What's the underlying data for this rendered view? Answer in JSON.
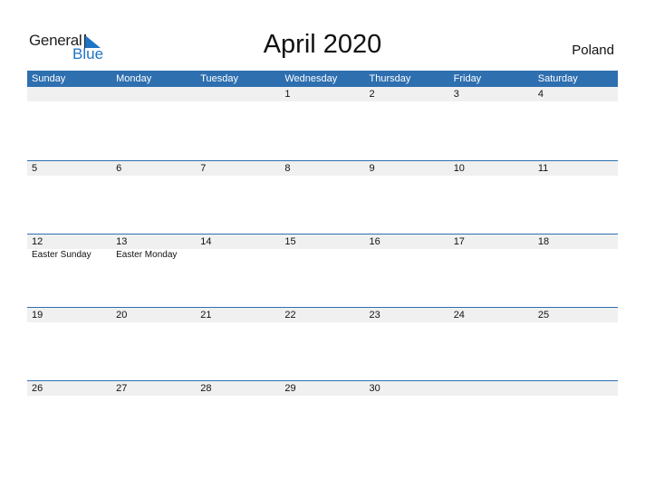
{
  "logo": {
    "general": "General",
    "blue": "Blue"
  },
  "title": "April 2020",
  "country": "Poland",
  "weekdays": [
    "Sunday",
    "Monday",
    "Tuesday",
    "Wednesday",
    "Thursday",
    "Friday",
    "Saturday"
  ],
  "colors": {
    "header": "#2e6fb0",
    "strip": "#f0f0f0",
    "brand_blue": "#1e74c4"
  },
  "weeks": [
    [
      {
        "day": ""
      },
      {
        "day": ""
      },
      {
        "day": ""
      },
      {
        "day": "1"
      },
      {
        "day": "2"
      },
      {
        "day": "3"
      },
      {
        "day": "4"
      }
    ],
    [
      {
        "day": "5"
      },
      {
        "day": "6"
      },
      {
        "day": "7"
      },
      {
        "day": "8"
      },
      {
        "day": "9"
      },
      {
        "day": "10"
      },
      {
        "day": "11"
      }
    ],
    [
      {
        "day": "12",
        "event": "Easter Sunday"
      },
      {
        "day": "13",
        "event": "Easter Monday"
      },
      {
        "day": "14"
      },
      {
        "day": "15"
      },
      {
        "day": "16"
      },
      {
        "day": "17"
      },
      {
        "day": "18"
      }
    ],
    [
      {
        "day": "19"
      },
      {
        "day": "20"
      },
      {
        "day": "21"
      },
      {
        "day": "22"
      },
      {
        "day": "23"
      },
      {
        "day": "24"
      },
      {
        "day": "25"
      }
    ],
    [
      {
        "day": "26"
      },
      {
        "day": "27"
      },
      {
        "day": "28"
      },
      {
        "day": "29"
      },
      {
        "day": "30"
      },
      {
        "day": ""
      },
      {
        "day": ""
      }
    ]
  ]
}
